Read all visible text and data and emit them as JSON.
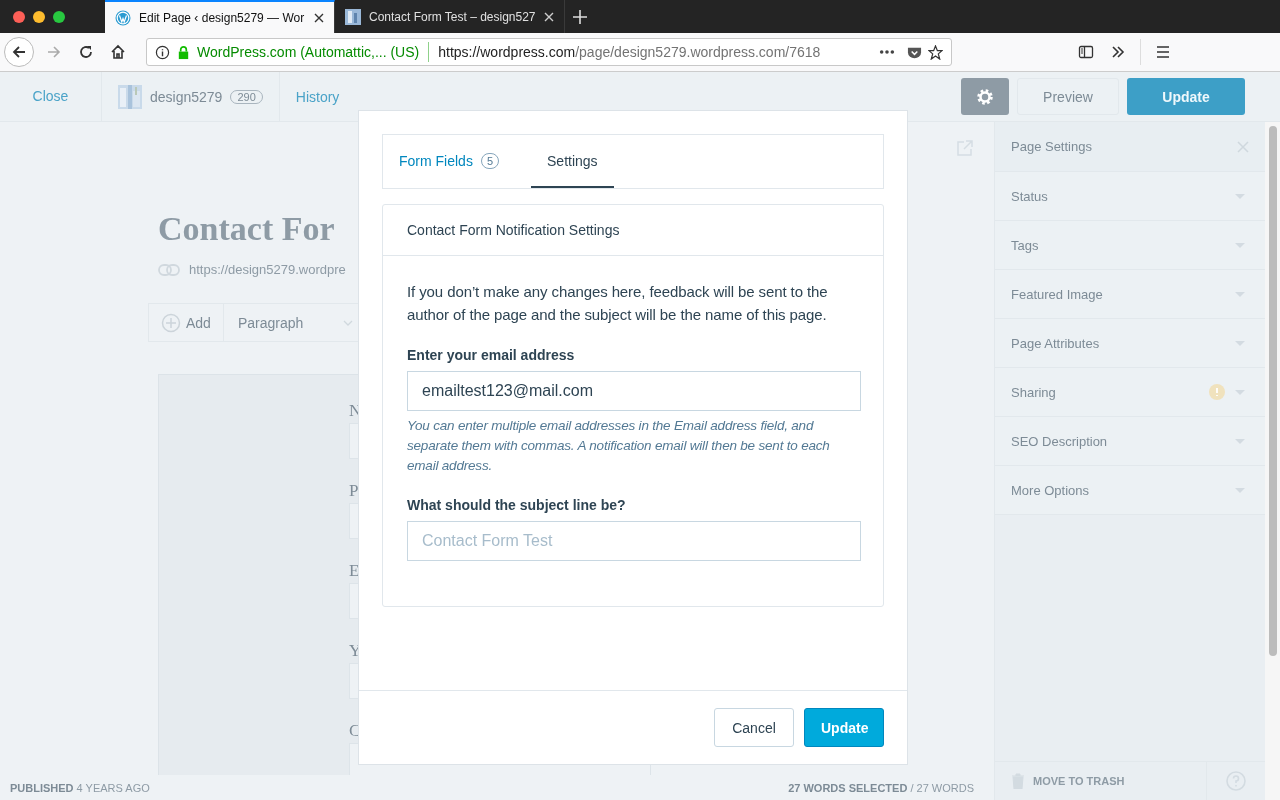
{
  "browser": {
    "tabs": [
      {
        "title": "Edit Page ‹ design5279 — Wor",
        "selected": true
      },
      {
        "title": "Contact Form Test – design527",
        "selected": false
      }
    ],
    "forward_disabled": true,
    "identity": "WordPress.com (Automattic,...  (US)",
    "url_host": "https://wordpress.com",
    "url_path": "/page/design5279.wordpress.com/7618"
  },
  "editor": {
    "top_bar": {
      "close": "Close",
      "site": "design5279",
      "count": "290",
      "history": "History",
      "preview": "Preview",
      "update": "Update"
    },
    "title": "Contact For",
    "permalink": "https://design5279.wordpre",
    "block_toolbar": {
      "add": "Add",
      "block_type": "Paragraph"
    },
    "form_preview_labels": [
      "N",
      "P",
      "E",
      "Y",
      "C"
    ],
    "status": {
      "state": "PUBLISHED",
      "age": "4 YEARS AGO"
    },
    "word_count": {
      "selected": "27 WORDS SELECTED",
      "total": "/ 27 WORDS"
    }
  },
  "sidebar": {
    "title": "Page Settings",
    "sections": [
      {
        "label": "Status",
        "warning": false
      },
      {
        "label": "Tags",
        "warning": false
      },
      {
        "label": "Featured Image",
        "warning": false
      },
      {
        "label": "Page Attributes",
        "warning": false
      },
      {
        "label": "Sharing",
        "warning": true
      },
      {
        "label": "SEO Description",
        "warning": false
      },
      {
        "label": "More Options",
        "warning": false
      }
    ],
    "trash": "MOVE TO TRASH"
  },
  "modal": {
    "tabs": [
      {
        "label": "Form Fields",
        "count": "5",
        "selected": false
      },
      {
        "label": "Settings",
        "selected": true
      }
    ],
    "card_title": "Contact Form Notification Settings",
    "intro": "If you don’t make any changes here, feedback will be sent to the author of the page and the subject will be the name of this page.",
    "email_label": "Enter your email address",
    "email_value": "emailtest123@mail.com",
    "help": "You can enter multiple email addresses in the Email address field, and separate them with commas. A notification email will then be sent to each email address.",
    "subject_label": "What should the subject line be?",
    "subject_placeholder": "Contact Form Test",
    "buttons": [
      {
        "label": "Cancel",
        "kind": "secondary"
      },
      {
        "label": "Update",
        "kind": "primary"
      }
    ]
  }
}
